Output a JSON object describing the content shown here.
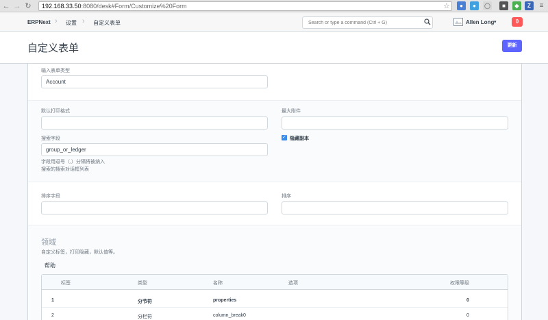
{
  "browser": {
    "url_host": "192.168.33.50",
    "url_path": ":8080/desk#Form/Customize%20Form"
  },
  "navbar": {
    "brand": "ERPNext",
    "breadcrumb_1": "设置",
    "breadcrumb_2": "自定义表单",
    "search_placeholder": "Search or type a command (Ctrl + G)",
    "user_name": "Allen Long",
    "notification_count": "0"
  },
  "page": {
    "title": "自定义表单",
    "update_button": "更新"
  },
  "form": {
    "doctype_label": "输入表单类型",
    "doctype_value": "Account",
    "default_print_format_label": "默认打印格式",
    "default_print_format_value": "",
    "max_attachments_label": "最大附件",
    "max_attachments_value": "",
    "search_fields_label": "搜索字段",
    "search_fields_value": "group_or_ledger",
    "search_fields_help_1": "字段用逗号（,）分隔将被纳入",
    "search_fields_help_2": "搜索的搜索对话框列表",
    "hide_copy_label": "隐藏副本",
    "hide_copy_checked": true,
    "sort_field_label": "排序字段",
    "sort_field_value": "",
    "sort_order_label": "排序",
    "sort_order_value": ""
  },
  "fields_section": {
    "heading": "领域",
    "description": "自定义标签，打印隐藏，默认值等。",
    "help_link": "帮助"
  },
  "grid": {
    "columns": [
      "标签",
      "类型",
      "名称",
      "选项",
      "权限等级"
    ],
    "rows": [
      [
        "1",
        "分节符",
        "properties",
        "",
        "0"
      ],
      [
        "2",
        "分栏符",
        "column_break0",
        "",
        "0"
      ]
    ]
  },
  "colors": {
    "primary": "#5e64ff",
    "notification": "#ff5858",
    "checkbox": "#3b8bea"
  }
}
